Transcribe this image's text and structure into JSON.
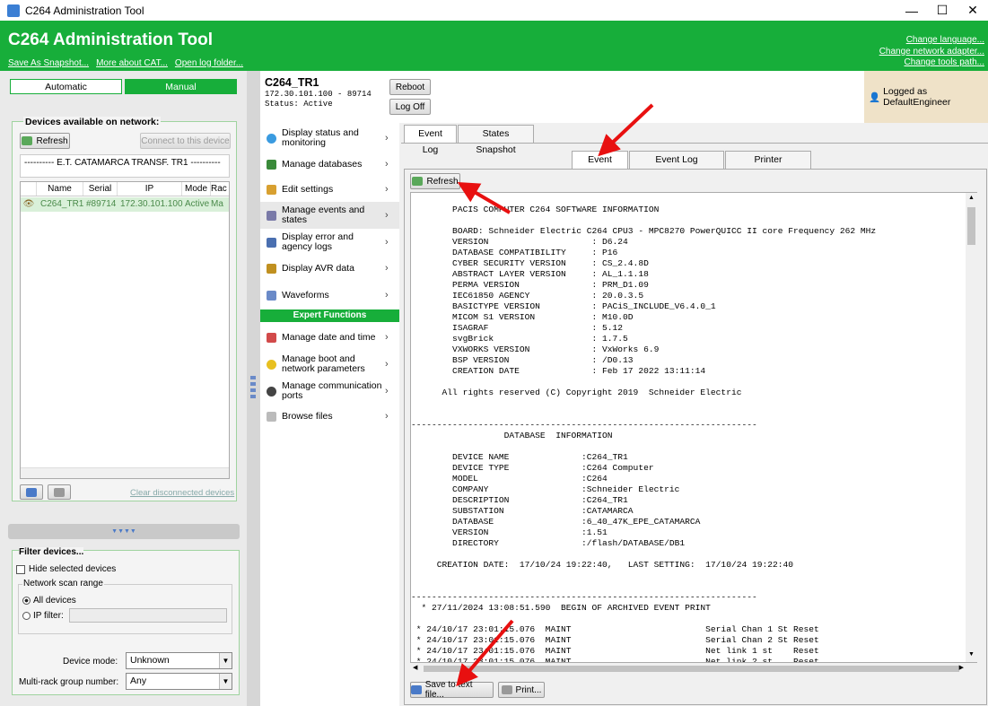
{
  "window": {
    "title": "C264 Administration Tool",
    "min": "—",
    "max": "☐",
    "close": "✕"
  },
  "banner": {
    "title": "C264 Administration Tool",
    "links": [
      "Save As Snapshot...",
      "More about CAT...",
      "Open log folder..."
    ],
    "right_links": [
      "Change language...",
      "Change network adapter...",
      "Change tools path..."
    ]
  },
  "left": {
    "tab_automatic": "Automatic",
    "tab_manual": "Manual",
    "devices_title": "Devices available on network:",
    "refresh": "Refresh",
    "connect": "Connect to this device",
    "substation": "---------- E.T. CATAMARCA TRANSF. TR1 ----------",
    "columns": [
      "Name",
      "Serial",
      "IP",
      "Mode",
      "Rac"
    ],
    "rows": [
      {
        "name": "C264_TR1",
        "serial": "#89714",
        "ip": "172.30.101.100",
        "mode": "Active",
        "rack": "Ma"
      }
    ],
    "clear": "Clear disconnected devices",
    "splitter": "▼▼▼▼",
    "filter_title": "Filter devices...",
    "hide_selected": "Hide selected devices",
    "scan_range": "Network scan range",
    "all_devices": "All devices",
    "ip_filter": "IP filter:",
    "device_mode_label": "Device mode:",
    "device_mode_value": "Unknown",
    "multirack_label": "Multi-rack group number:",
    "multirack_value": "Any"
  },
  "header": {
    "device": "C264_TR1",
    "address": "172.30.101.100 - 89714",
    "status": "Status: Active",
    "reboot": "Reboot",
    "logoff": "Log Off",
    "logged": "Logged as DefaultEngineer"
  },
  "menu": {
    "items": [
      {
        "label": "Display status and monitoring",
        "color": "#3a9be0"
      },
      {
        "label": "Manage databases",
        "color": "#3a8a3a"
      },
      {
        "label": "Edit settings",
        "color": "#d8a030"
      },
      {
        "label": "Manage events and states",
        "color": "#7a7aa8"
      },
      {
        "label": "Display error and agency logs",
        "color": "#4a6fb0"
      },
      {
        "label": "Display AVR data",
        "color": "#c09020"
      }
    ],
    "waveforms": "Waveforms",
    "expert": "Expert Functions",
    "expert_items": [
      "Manage date and time",
      "Manage boot and network parameters",
      "Manage communication ports",
      "Browse files"
    ]
  },
  "tabs": {
    "top": [
      "Event Log",
      "States Snapshot"
    ],
    "sub": [
      "Event Log",
      "Event Log Parameters",
      "Printer Parameters"
    ]
  },
  "content": {
    "refresh": "Refresh",
    "save": "Save to text file...",
    "print": "Print...",
    "log_lines": [
      "        PACIS COMPUTER C264 SOFTWARE INFORMATION",
      "",
      "        BOARD: Schneider Electric C264 CPU3 - MPC8270 PowerQUICC II core Frequency 262 MHz",
      "        VERSION                    : D6.24",
      "        DATABASE COMPATIBILITY     : P16",
      "        CYBER SECURITY VERSION     : CS_2.4.8D",
      "        ABSTRACT LAYER VERSION     : AL_1.1.18",
      "        PERMA VERSION              : PRM_D1.09",
      "        IEC61850 AGENCY            : 20.0.3.5",
      "        BASICTYPE VERSION          : PACiS_INCLUDE_V6.4.0_1",
      "        MICOM S1 VERSION           : M10.0D",
      "        ISAGRAF                    : 5.12",
      "        svgBrick                   : 1.7.5",
      "        VXWORKS VERSION            : VxWorks 6.9",
      "        BSP VERSION                : /D0.13",
      "        CREATION DATE              : Feb 17 2022 13:11:14",
      "",
      "      All rights reserved (C) Copyright 2019  Schneider Electric",
      "",
      "",
      "-------------------------------------------------------------------",
      "                  DATABASE  INFORMATION",
      "",
      "        DEVICE NAME              :C264_TR1",
      "        DEVICE TYPE              :C264 Computer",
      "        MODEL                    :C264",
      "        COMPANY                  :Schneider Electric",
      "        DESCRIPTION              :C264_TR1",
      "        SUBSTATION               :CATAMARCA",
      "        DATABASE                 :6_40_47K_EPE_CATAMARCA",
      "        VERSION                  :1.51",
      "        DIRECTORY                :/flash/DATABASE/DB1",
      "",
      "     CREATION DATE:  17/10/24 19:22:40,   LAST SETTING:  17/10/24 19:22:40",
      "",
      "",
      "-------------------------------------------------------------------",
      "  * 27/11/2024 13:08:51.590  BEGIN OF ARCHIVED EVENT PRINT",
      "",
      " * 24/10/17 23:01:15.076  MAINT                          Serial Chan 1 St Reset",
      " * 24/10/17 23:01:15.076  MAINT                          Serial Chan 2 St Reset",
      " * 24/10/17 23:01:15.076  MAINT                          Net link 1 st    Reset",
      " * 24/10/17 23:01:15.076  MAINT                          Net link 2 st    Reset"
    ]
  }
}
